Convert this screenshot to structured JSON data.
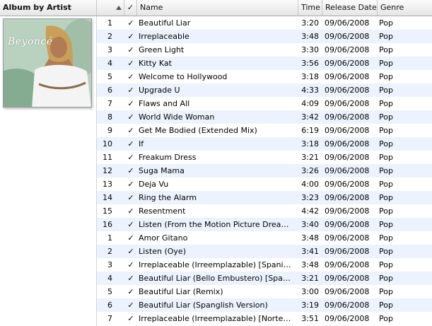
{
  "columns": {
    "album_by_artist": "Album by Artist",
    "check": "✓",
    "name": "Name",
    "time": "Time",
    "release_date": "Release Date",
    "genre": "Genre"
  },
  "album": {
    "cover_text": "Beyoncé",
    "colors": {
      "sky": "#b9d2bf",
      "foliage": "#6f9a7c",
      "dress": "#f4f4f4",
      "skin": "#b07b55"
    }
  },
  "check_glyph": "✓",
  "tracks": [
    {
      "num": "1",
      "name": "Beautiful Liar",
      "time": "3:20",
      "date": "09/06/2008",
      "genre": "Pop"
    },
    {
      "num": "2",
      "name": "Irreplaceable",
      "time": "3:48",
      "date": "09/06/2008",
      "genre": "Pop"
    },
    {
      "num": "3",
      "name": "Green Light",
      "time": "3:30",
      "date": "09/06/2008",
      "genre": "Pop"
    },
    {
      "num": "4",
      "name": "Kitty Kat",
      "time": "3:56",
      "date": "09/06/2008",
      "genre": "Pop"
    },
    {
      "num": "5",
      "name": "Welcome to Hollywood",
      "time": "3:18",
      "date": "09/06/2008",
      "genre": "Pop"
    },
    {
      "num": "6",
      "name": "Upgrade U",
      "time": "4:33",
      "date": "09/06/2008",
      "genre": "Pop"
    },
    {
      "num": "7",
      "name": "Flaws and All",
      "time": "4:09",
      "date": "09/06/2008",
      "genre": "Pop"
    },
    {
      "num": "8",
      "name": "World Wide Woman",
      "time": "3:42",
      "date": "09/06/2008",
      "genre": "Pop"
    },
    {
      "num": "9",
      "name": "Get Me Bodied (Extended Mix)",
      "time": "6:19",
      "date": "09/06/2008",
      "genre": "Pop"
    },
    {
      "num": "10",
      "name": "If",
      "time": "3:18",
      "date": "09/06/2008",
      "genre": "Pop"
    },
    {
      "num": "11",
      "name": "Freakum Dress",
      "time": "3:21",
      "date": "09/06/2008",
      "genre": "Pop"
    },
    {
      "num": "12",
      "name": "Suga Mama",
      "time": "3:26",
      "date": "09/06/2008",
      "genre": "Pop"
    },
    {
      "num": "13",
      "name": "Deja Vu",
      "time": "4:00",
      "date": "09/06/2008",
      "genre": "Pop"
    },
    {
      "num": "14",
      "name": "Ring the Alarm",
      "time": "3:23",
      "date": "09/06/2008",
      "genre": "Pop"
    },
    {
      "num": "15",
      "name": "Resentment",
      "time": "4:42",
      "date": "09/06/2008",
      "genre": "Pop"
    },
    {
      "num": "16",
      "name": "Listen (From the Motion Picture Dreamg...",
      "time": "3:40",
      "date": "09/06/2008",
      "genre": "Pop"
    },
    {
      "num": "1",
      "name": "Amor Gitano",
      "time": "3:48",
      "date": "09/06/2008",
      "genre": "Pop"
    },
    {
      "num": "2",
      "name": "Listen (Oye)",
      "time": "3:41",
      "date": "09/06/2008",
      "genre": "Pop"
    },
    {
      "num": "3",
      "name": "Irreplaceable (Irreemplazable) [Spanish ...",
      "time": "3:48",
      "date": "09/06/2008",
      "genre": "Pop"
    },
    {
      "num": "4",
      "name": "Beautiful Liar (Bello Embustero) [Spanis...",
      "time": "3:21",
      "date": "09/06/2008",
      "genre": "Pop"
    },
    {
      "num": "5",
      "name": "Beautiful Liar (Remix)",
      "time": "3:00",
      "date": "09/06/2008",
      "genre": "Pop"
    },
    {
      "num": "6",
      "name": "Beautiful Liar (Spanglish Version)",
      "time": "3:19",
      "date": "09/06/2008",
      "genre": "Pop"
    },
    {
      "num": "7",
      "name": "Irreplaceable (Irreemplazable) [Nortena ...",
      "time": "3:51",
      "date": "09/06/2008",
      "genre": "Pop"
    }
  ]
}
